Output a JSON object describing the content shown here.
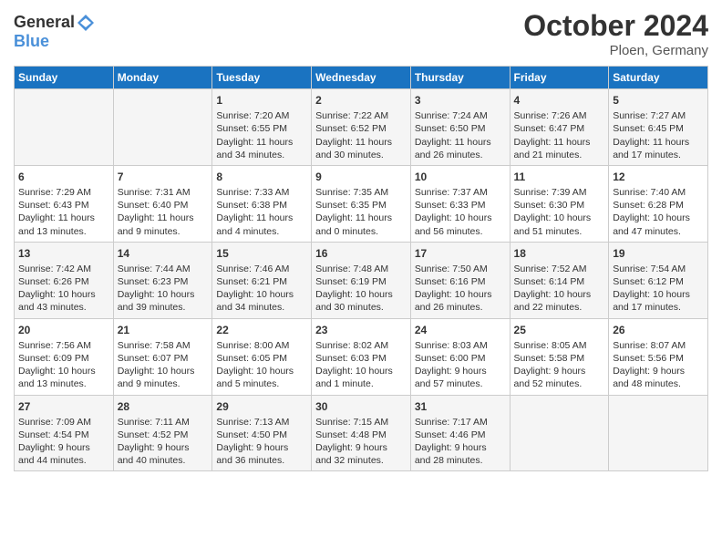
{
  "header": {
    "logo_line1": "General",
    "logo_line2": "Blue",
    "month": "October 2024",
    "location": "Ploen, Germany"
  },
  "weekdays": [
    "Sunday",
    "Monday",
    "Tuesday",
    "Wednesday",
    "Thursday",
    "Friday",
    "Saturday"
  ],
  "rows": [
    [
      {
        "day": "",
        "content": ""
      },
      {
        "day": "",
        "content": ""
      },
      {
        "day": "1",
        "content": "Sunrise: 7:20 AM\nSunset: 6:55 PM\nDaylight: 11 hours\nand 34 minutes."
      },
      {
        "day": "2",
        "content": "Sunrise: 7:22 AM\nSunset: 6:52 PM\nDaylight: 11 hours\nand 30 minutes."
      },
      {
        "day": "3",
        "content": "Sunrise: 7:24 AM\nSunset: 6:50 PM\nDaylight: 11 hours\nand 26 minutes."
      },
      {
        "day": "4",
        "content": "Sunrise: 7:26 AM\nSunset: 6:47 PM\nDaylight: 11 hours\nand 21 minutes."
      },
      {
        "day": "5",
        "content": "Sunrise: 7:27 AM\nSunset: 6:45 PM\nDaylight: 11 hours\nand 17 minutes."
      }
    ],
    [
      {
        "day": "6",
        "content": "Sunrise: 7:29 AM\nSunset: 6:43 PM\nDaylight: 11 hours\nand 13 minutes."
      },
      {
        "day": "7",
        "content": "Sunrise: 7:31 AM\nSunset: 6:40 PM\nDaylight: 11 hours\nand 9 minutes."
      },
      {
        "day": "8",
        "content": "Sunrise: 7:33 AM\nSunset: 6:38 PM\nDaylight: 11 hours\nand 4 minutes."
      },
      {
        "day": "9",
        "content": "Sunrise: 7:35 AM\nSunset: 6:35 PM\nDaylight: 11 hours\nand 0 minutes."
      },
      {
        "day": "10",
        "content": "Sunrise: 7:37 AM\nSunset: 6:33 PM\nDaylight: 10 hours\nand 56 minutes."
      },
      {
        "day": "11",
        "content": "Sunrise: 7:39 AM\nSunset: 6:30 PM\nDaylight: 10 hours\nand 51 minutes."
      },
      {
        "day": "12",
        "content": "Sunrise: 7:40 AM\nSunset: 6:28 PM\nDaylight: 10 hours\nand 47 minutes."
      }
    ],
    [
      {
        "day": "13",
        "content": "Sunrise: 7:42 AM\nSunset: 6:26 PM\nDaylight: 10 hours\nand 43 minutes."
      },
      {
        "day": "14",
        "content": "Sunrise: 7:44 AM\nSunset: 6:23 PM\nDaylight: 10 hours\nand 39 minutes."
      },
      {
        "day": "15",
        "content": "Sunrise: 7:46 AM\nSunset: 6:21 PM\nDaylight: 10 hours\nand 34 minutes."
      },
      {
        "day": "16",
        "content": "Sunrise: 7:48 AM\nSunset: 6:19 PM\nDaylight: 10 hours\nand 30 minutes."
      },
      {
        "day": "17",
        "content": "Sunrise: 7:50 AM\nSunset: 6:16 PM\nDaylight: 10 hours\nand 26 minutes."
      },
      {
        "day": "18",
        "content": "Sunrise: 7:52 AM\nSunset: 6:14 PM\nDaylight: 10 hours\nand 22 minutes."
      },
      {
        "day": "19",
        "content": "Sunrise: 7:54 AM\nSunset: 6:12 PM\nDaylight: 10 hours\nand 17 minutes."
      }
    ],
    [
      {
        "day": "20",
        "content": "Sunrise: 7:56 AM\nSunset: 6:09 PM\nDaylight: 10 hours\nand 13 minutes."
      },
      {
        "day": "21",
        "content": "Sunrise: 7:58 AM\nSunset: 6:07 PM\nDaylight: 10 hours\nand 9 minutes."
      },
      {
        "day": "22",
        "content": "Sunrise: 8:00 AM\nSunset: 6:05 PM\nDaylight: 10 hours\nand 5 minutes."
      },
      {
        "day": "23",
        "content": "Sunrise: 8:02 AM\nSunset: 6:03 PM\nDaylight: 10 hours\nand 1 minute."
      },
      {
        "day": "24",
        "content": "Sunrise: 8:03 AM\nSunset: 6:00 PM\nDaylight: 9 hours\nand 57 minutes."
      },
      {
        "day": "25",
        "content": "Sunrise: 8:05 AM\nSunset: 5:58 PM\nDaylight: 9 hours\nand 52 minutes."
      },
      {
        "day": "26",
        "content": "Sunrise: 8:07 AM\nSunset: 5:56 PM\nDaylight: 9 hours\nand 48 minutes."
      }
    ],
    [
      {
        "day": "27",
        "content": "Sunrise: 7:09 AM\nSunset: 4:54 PM\nDaylight: 9 hours\nand 44 minutes."
      },
      {
        "day": "28",
        "content": "Sunrise: 7:11 AM\nSunset: 4:52 PM\nDaylight: 9 hours\nand 40 minutes."
      },
      {
        "day": "29",
        "content": "Sunrise: 7:13 AM\nSunset: 4:50 PM\nDaylight: 9 hours\nand 36 minutes."
      },
      {
        "day": "30",
        "content": "Sunrise: 7:15 AM\nSunset: 4:48 PM\nDaylight: 9 hours\nand 32 minutes."
      },
      {
        "day": "31",
        "content": "Sunrise: 7:17 AM\nSunset: 4:46 PM\nDaylight: 9 hours\nand 28 minutes."
      },
      {
        "day": "",
        "content": ""
      },
      {
        "day": "",
        "content": ""
      }
    ]
  ]
}
